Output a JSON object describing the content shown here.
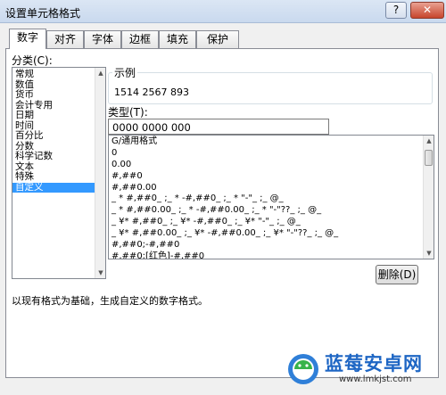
{
  "window": {
    "title": "设置单元格格式",
    "help": "?",
    "close": "✕"
  },
  "tabs": [
    "数字",
    "对齐",
    "字体",
    "边框",
    "填充",
    "保护"
  ],
  "category": {
    "label": "分类(C):",
    "items": [
      "常规",
      "数值",
      "货币",
      "会计专用",
      "日期",
      "时间",
      "百分比",
      "分数",
      "科学记数",
      "文本",
      "特殊",
      "自定义"
    ],
    "selected": "自定义"
  },
  "sample": {
    "label": "示例",
    "value": "1514 2567 893"
  },
  "type": {
    "label": "类型(T):",
    "value": "0000 0000 000",
    "formats": [
      "G/通用格式",
      "0",
      "0.00",
      "#,##0",
      "#,##0.00",
      "_ * #,##0_ ;_ * -#,##0_ ;_ * \"-\"_ ;_ @_",
      "_ * #,##0.00_ ;_ * -#,##0.00_ ;_ * \"-\"??_ ;_ @_",
      "_ ¥* #,##0_ ;_ ¥* -#,##0_ ;_ ¥* \"-\"_ ;_ @_",
      "_ ¥* #,##0.00_ ;_ ¥* -#,##0.00_ ;_ ¥* \"-\"??_ ;_ @_",
      "#,##0;-#,##0",
      "#,##0;[红色]-#,##0"
    ]
  },
  "delete_button": "删除(D)",
  "description": "以现有格式为基础，生成自定义的数字格式。",
  "watermark": {
    "brand": "蓝莓安卓网",
    "url": "www.lmkjst.com"
  },
  "colors": {
    "accent": "#3399ff",
    "title_gradient": "#dbe6f4"
  }
}
